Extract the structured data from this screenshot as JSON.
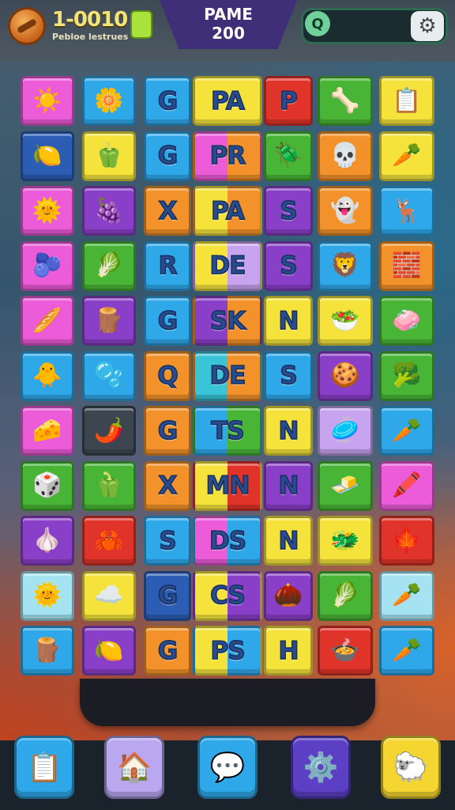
{
  "header": {
    "coin_value": "1-0010",
    "coin_caption": "Pebloe lestrues",
    "level_title": "PAME",
    "level_value": "200",
    "search_icon": "Q",
    "search_placeholder": "",
    "settings_icon": "gear-icon",
    "coin_icon": "coin-icon",
    "gem_icon": "green-gem-icon"
  },
  "colors": {
    "pink": "#ec5bd8",
    "blue": "#2fa8ea",
    "yellow": "#f5e33c",
    "red": "#e0342a",
    "green": "#48b536",
    "orange": "#f3922a",
    "purple": "#8a3fc8",
    "navy": "#2c5db4",
    "teal": "#39c4d8",
    "lightblue": "#a6e3f2",
    "lavender": "#c8a3f0",
    "darkgray": "#3d4650",
    "lime": "#8fe04a"
  },
  "grid": [
    [
      {
        "k": "pink",
        "i": "☀️",
        "n": "sun-icon"
      },
      {
        "k": "blue",
        "i": "🌼",
        "n": "flower-icon"
      },
      {
        "k": "blue",
        "t": "G"
      },
      {
        "k": "yellow",
        "t": "PA"
      },
      {
        "k": "red",
        "t": "P"
      },
      {
        "k": "green",
        "i": "🦴",
        "n": "bone-icon"
      },
      {
        "k": "yellow",
        "i": "📋",
        "n": "clipboard-icon"
      }
    ],
    [
      {
        "k": "navy",
        "i": "🍋",
        "n": "lemon-icon"
      },
      {
        "k": "yellow",
        "i": "🫑",
        "n": "pepper-icon"
      },
      {
        "k": "blue",
        "t": "G"
      },
      {
        "k": "pink",
        "k2": "orange",
        "t": "PR"
      },
      {
        "k": "green",
        "i": "🪲",
        "n": "beetle-icon"
      },
      {
        "k": "orange",
        "i": "💀",
        "n": "skull-icon"
      },
      {
        "k": "yellow",
        "i": "🥕",
        "n": "carrot-icon"
      }
    ],
    [
      {
        "k": "pink",
        "i": "🌞",
        "n": "sun-face-icon"
      },
      {
        "k": "purple",
        "i": "🍇",
        "n": "berry-icon"
      },
      {
        "k": "orange",
        "t": "X"
      },
      {
        "k": "yellow",
        "k2": "orange",
        "t": "PA"
      },
      {
        "k": "purple",
        "t": "S"
      },
      {
        "k": "orange",
        "i": "👻",
        "n": "ghost-icon"
      },
      {
        "k": "blue",
        "i": "🦌",
        "n": "deer-icon"
      }
    ],
    [
      {
        "k": "pink",
        "i": "🫐",
        "n": "plum-icon"
      },
      {
        "k": "green",
        "i": "🥬",
        "n": "leaf-icon"
      },
      {
        "k": "blue",
        "t": "R"
      },
      {
        "k": "yellow",
        "k2": "lavender",
        "t": "DE"
      },
      {
        "k": "purple",
        "t": "S"
      },
      {
        "k": "blue",
        "i": "🦁",
        "n": "lion-icon"
      },
      {
        "k": "orange",
        "i": "🧱",
        "n": "brick-icon"
      }
    ],
    [
      {
        "k": "pink",
        "i": "🥖",
        "n": "baguette-icon"
      },
      {
        "k": "purple",
        "i": "🪵",
        "n": "totem-icon"
      },
      {
        "k": "blue",
        "t": "G"
      },
      {
        "k": "purple",
        "k2": "orange",
        "t": "SK"
      },
      {
        "k": "yellow",
        "t": "N"
      },
      {
        "k": "yellow",
        "i": "🥗",
        "n": "salad-icon"
      },
      {
        "k": "green",
        "i": "🧼",
        "n": "soap-icon"
      }
    ],
    [
      {
        "k": "blue",
        "i": "🐥",
        "n": "chick-icon"
      },
      {
        "k": "blue",
        "i": "🫧",
        "n": "cloud-icon"
      },
      {
        "k": "orange",
        "t": "Q"
      },
      {
        "k": "teal",
        "k2": "orange",
        "t": "DE"
      },
      {
        "k": "blue",
        "t": "S"
      },
      {
        "k": "purple",
        "i": "🍪",
        "n": "cookie-icon"
      },
      {
        "k": "green",
        "i": "🥦",
        "n": "broccoli-icon"
      }
    ],
    [
      {
        "k": "pink",
        "i": "🧀",
        "n": "cheese-icon"
      },
      {
        "k": "darkgray",
        "i": "🌶️",
        "n": "chili-icon"
      },
      {
        "k": "orange",
        "t": "G"
      },
      {
        "k": "blue",
        "k2": "green",
        "t": "TS"
      },
      {
        "k": "yellow",
        "t": "N"
      },
      {
        "k": "lavender",
        "i": "🥏",
        "n": "disc-icon"
      },
      {
        "k": "blue",
        "i": "🥕",
        "n": "carrot-icon"
      }
    ],
    [
      {
        "k": "green",
        "i": "🎲",
        "n": "dice-icon"
      },
      {
        "k": "green",
        "i": "🫑",
        "n": "pepper-icon"
      },
      {
        "k": "orange",
        "t": "X"
      },
      {
        "k": "yellow",
        "k2": "red",
        "t": "MN"
      },
      {
        "k": "purple",
        "t": "N"
      },
      {
        "k": "green",
        "i": "🧈",
        "n": "butter-icon"
      },
      {
        "k": "pink",
        "i": "🖍️",
        "n": "crayon-icon"
      }
    ],
    [
      {
        "k": "purple",
        "i": "🧄",
        "n": "garlic-icon"
      },
      {
        "k": "red",
        "i": "🦀",
        "n": "crab-icon"
      },
      {
        "k": "blue",
        "t": "S"
      },
      {
        "k": "pink",
        "k2": "blue",
        "t": "DS"
      },
      {
        "k": "yellow",
        "t": "N"
      },
      {
        "k": "yellow",
        "i": "🐲",
        "n": "dragon-icon"
      },
      {
        "k": "red",
        "i": "🍁",
        "n": "leaf-star-icon"
      }
    ],
    [
      {
        "k": "lightblue",
        "i": "🌞",
        "n": "sun-icon"
      },
      {
        "k": "yellow",
        "i": "☁️",
        "n": "blue-cloud-icon"
      },
      {
        "k": "navy",
        "t": "G"
      },
      {
        "k": "yellow",
        "k2": "purple",
        "t": "CS"
      },
      {
        "k": "purple",
        "i": "🌰",
        "n": "nut-icon"
      },
      {
        "k": "green",
        "i": "🥬",
        "n": "cabbage-icon"
      },
      {
        "k": "lightblue",
        "i": "🥕",
        "n": "carrot-icon"
      }
    ],
    [
      {
        "k": "blue",
        "i": "🪵",
        "n": "totem-icon"
      },
      {
        "k": "purple",
        "i": "🍋",
        "n": "lemon-icon"
      },
      {
        "k": "orange",
        "t": "G"
      },
      {
        "k": "yellow",
        "k2": "blue",
        "t": "PS"
      },
      {
        "k": "yellow",
        "t": "H"
      },
      {
        "k": "red",
        "i": "🍲",
        "n": "bowl-icon"
      },
      {
        "k": "blue",
        "i": "🥕",
        "n": "carrot-icon"
      }
    ]
  ],
  "dock": [
    {
      "name": "list-menu-button",
      "icon": "📋",
      "color": "#2fa8ea"
    },
    {
      "name": "shop-tower-button",
      "icon": "🏠",
      "color": "#b9a7f0"
    },
    {
      "name": "chat-bubble-button",
      "icon": "💬",
      "color": "#2fa8ea"
    },
    {
      "name": "settings-gear-button",
      "icon": "⚙️",
      "color": "#5b3fc4"
    },
    {
      "name": "creature-button",
      "icon": "🐑",
      "color": "#f5d630"
    }
  ]
}
